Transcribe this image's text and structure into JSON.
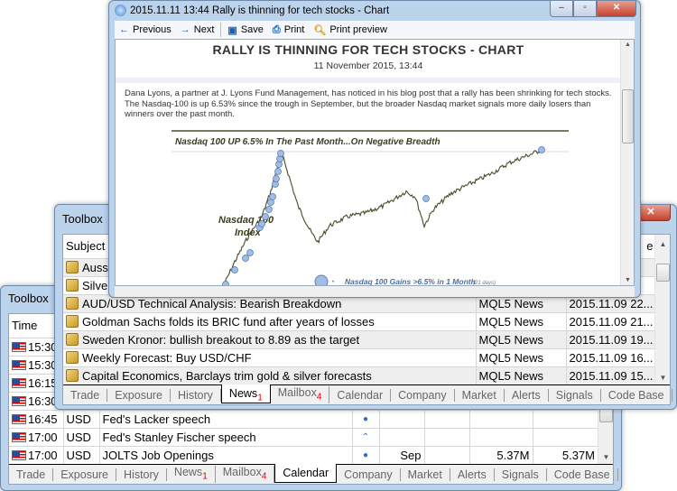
{
  "calendar_toolbox": {
    "title": "Toolbox",
    "columns": [
      "Time"
    ],
    "rows": [
      {
        "time": "15:30",
        "currency": "",
        "event": "",
        "importance": "",
        "period": "",
        "actual": "",
        "forecast": "",
        "previous": ""
      },
      {
        "time": "15:30",
        "currency": "",
        "event": "",
        "importance": "",
        "period": "",
        "actual": "",
        "forecast": "",
        "previous": ""
      },
      {
        "time": "16:15",
        "currency": "",
        "event": "",
        "importance": "",
        "period": "",
        "actual": "",
        "forecast": "",
        "previous": ""
      },
      {
        "time": "16:30",
        "currency": "",
        "event": "",
        "importance": "",
        "period": "",
        "actual": "",
        "forecast": "",
        "previous": ""
      },
      {
        "time": "16:45",
        "currency": "USD",
        "event": "Fed's Lacker speech",
        "importance": "low",
        "period": "",
        "actual": "",
        "forecast": "",
        "previous": ""
      },
      {
        "time": "17:00",
        "currency": "USD",
        "event": "Fed's Stanley Fischer speech",
        "importance": "medium",
        "period": "",
        "actual": "",
        "forecast": "",
        "previous": ""
      },
      {
        "time": "17:00",
        "currency": "USD",
        "event": "JOLTS Job Openings",
        "importance": "low",
        "period": "Sep",
        "actual": "",
        "forecast": "5.37M",
        "previous": "5.37M"
      }
    ],
    "tabs": [
      {
        "label": "Trade"
      },
      {
        "label": "Exposure"
      },
      {
        "label": "History"
      },
      {
        "label": "News",
        "badge": "1"
      },
      {
        "label": "Mailbox",
        "badge": "4"
      },
      {
        "label": "Calendar",
        "active": true
      },
      {
        "label": "Company"
      },
      {
        "label": "Market"
      },
      {
        "label": "Alerts"
      },
      {
        "label": "Signals"
      },
      {
        "label": "Code Base"
      }
    ]
  },
  "news_toolbox": {
    "title": "Toolbox",
    "columns": {
      "subject": "Subject",
      "date_partial": "e"
    },
    "rows": [
      {
        "subject": "Aussi",
        "source": "",
        "date": "",
        "unread": true
      },
      {
        "subject": "Silver",
        "source": "",
        "date": "",
        "unread": true
      },
      {
        "subject": "AUD/USD Technical Analysis: Bearish Breakdown",
        "source": "MQL5 News",
        "date": "2015.11.09 22...",
        "unread": true
      },
      {
        "subject": "Goldman Sachs folds its BRIC fund after years of losses",
        "source": "MQL5 News",
        "date": "2015.11.09 21...",
        "unread": true
      },
      {
        "subject": "Sweden Kronor: bullish breakout to 8.89 as the target",
        "source": "MQL5 News",
        "date": "2015.11.09 19...",
        "unread": true
      },
      {
        "subject": "Weekly Forecast: Buy USD/CHF",
        "source": "MQL5 News",
        "date": "2015.11.09 16...",
        "unread": true
      },
      {
        "subject": "Capital Economics, Barclays trim gold & silver forecasts",
        "source": "MQL5 News",
        "date": "2015.11.09 15...",
        "unread": true
      }
    ],
    "tabs": [
      {
        "label": "Trade"
      },
      {
        "label": "Exposure"
      },
      {
        "label": "History"
      },
      {
        "label": "News",
        "badge": "1",
        "active": true
      },
      {
        "label": "Mailbox",
        "badge": "4"
      },
      {
        "label": "Calendar"
      },
      {
        "label": "Company"
      },
      {
        "label": "Market"
      },
      {
        "label": "Alerts"
      },
      {
        "label": "Signals"
      },
      {
        "label": "Code Base"
      }
    ]
  },
  "article_window": {
    "title": "2015.11.11 13:44 Rally is thinning for tech stocks - Chart",
    "toolbar": {
      "previous": "Previous",
      "next": "Next",
      "save": "Save",
      "print": "Print",
      "print_preview": "Print preview"
    },
    "headline": "RALLY IS THINNING FOR TECH STOCKS - CHART",
    "date": "11 November 2015, 13:44",
    "body": "Dana Lyons, a partner at J. Lyons Fund Management, has noticed in his blog post that a rally has been shrinking for tech stocks. The Nasdaq-100 is up 6.53% since the trough in September, but the broader Nasdaq market signals more daily losers than winners over the past month.",
    "image": {
      "title": "Nasdaq 100 UP 6.5% In The Past Month...On Negative Breadth",
      "series_label": "Nasdaq 100 Index",
      "legend": "Nasdaq 100 Gains >6.5% in 1 Month",
      "legend_note": "(21 days)"
    }
  },
  "colors": {
    "window_frame": "#bcd3ec",
    "close_button": "#c7402c",
    "badge": "#dd0000",
    "chart_line": "#4a4a2a",
    "marker": "#7ea6d8"
  }
}
